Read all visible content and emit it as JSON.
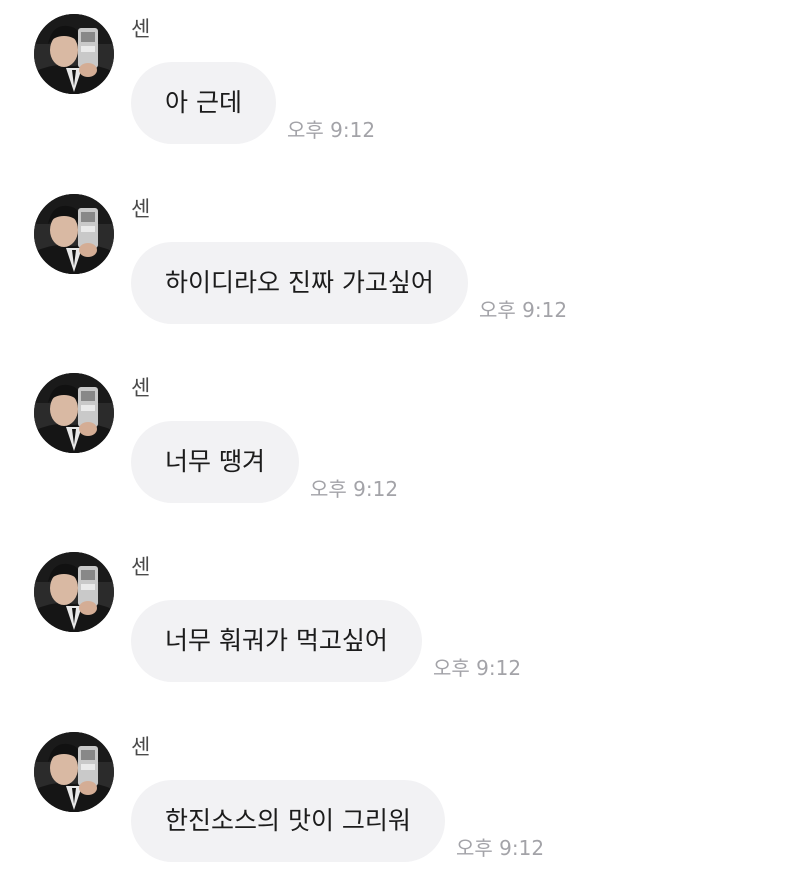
{
  "messages": [
    {
      "sender": "센",
      "text": "아 근데",
      "time": "오후 9:12"
    },
    {
      "sender": "센",
      "text": "하이디라오 진짜 가고싶어",
      "time": "오후 9:12"
    },
    {
      "sender": "센",
      "text": "너무 땡겨",
      "time": "오후 9:12"
    },
    {
      "sender": "센",
      "text": "너무 훠궈가 먹고싶어",
      "time": "오후 9:12"
    },
    {
      "sender": "센",
      "text": "한진소스의 맛이 그리워",
      "time": "오후 9:12"
    }
  ],
  "avatar": {
    "icon": "profile-photo-avatar"
  }
}
